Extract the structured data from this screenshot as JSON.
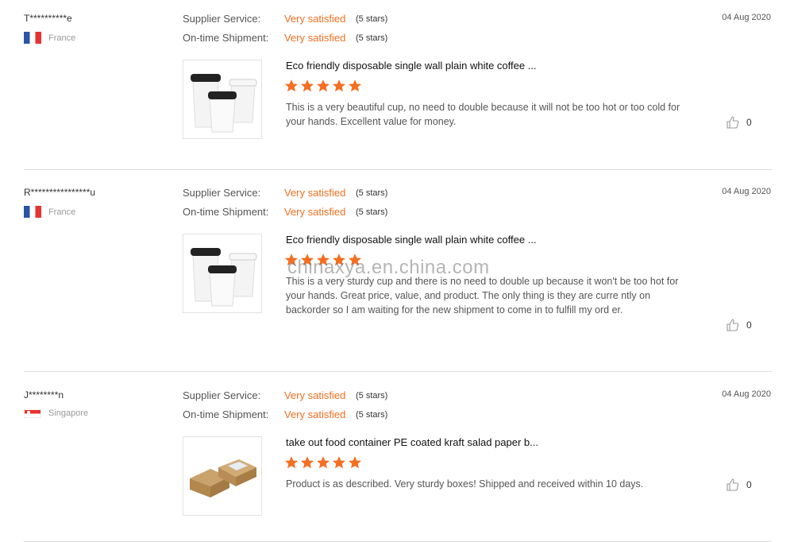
{
  "labels": {
    "supplier_service": "Supplier Service:",
    "ontime_shipment": "On-time Shipment:"
  },
  "colors": {
    "accent": "#f36f21",
    "divider": "#dcdcdc"
  },
  "reviews": [
    {
      "user": "T**********e",
      "country": "France",
      "flag": "france-flag-icon",
      "date": "04 Aug 2020",
      "supplier_rating": "Very satisfied",
      "supplier_stars": "(5 stars)",
      "shipment_rating": "Very satisfied",
      "shipment_stars": "(5 stars)",
      "product_title": "Eco friendly disposable single wall plain white coffee ...",
      "product_image": "coffee-cups-image",
      "stars": 5,
      "text": "This is a very beautiful cup, no need to double because it will not be too hot or too cold for your hands. Excellent value for money.",
      "likes": "0"
    },
    {
      "user": "R****************u",
      "country": "France",
      "flag": "france-flag-icon",
      "date": "04 Aug 2020",
      "supplier_rating": "Very satisfied",
      "supplier_stars": "(5 stars)",
      "shipment_rating": "Very satisfied",
      "shipment_stars": "(5 stars)",
      "product_title": "Eco friendly disposable single wall plain white coffee ...",
      "product_image": "coffee-cups-image",
      "stars": 5,
      "text": "This is a very sturdy cup and there is no need to double up because it won't be too hot for your hands. Great price, value, and product. The only thing is they are curre ntly on backorder so I am waiting for the new shipment to come in to fulfill my ord er.",
      "likes": "0"
    },
    {
      "user": "J********n",
      "country": "Singapore",
      "flag": "singapore-flag-icon",
      "date": "04 Aug 2020",
      "supplier_rating": "Very satisfied",
      "supplier_stars": "(5 stars)",
      "shipment_rating": "Very satisfied",
      "shipment_stars": "(5 stars)",
      "product_title": "take out food container PE coated kraft salad paper b...",
      "product_image": "kraft-boxes-image",
      "stars": 5,
      "text": "Product is as described. Very sturdy boxes! Shipped and received within 10 days.",
      "likes": "0"
    }
  ],
  "watermark": "chinaxya.en.china.com"
}
